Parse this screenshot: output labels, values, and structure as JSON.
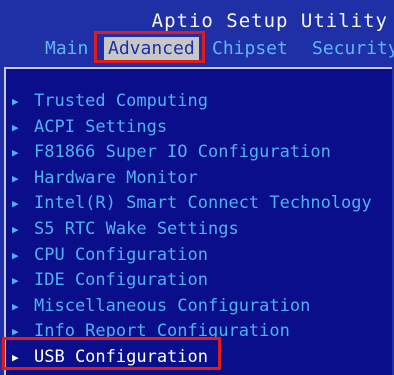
{
  "header": {
    "title": "Aptio Setup Utility",
    "tabs": [
      {
        "label": "Main"
      },
      {
        "label": "Advanced"
      },
      {
        "label": "Chipset"
      },
      {
        "label": "Security"
      }
    ],
    "active_tab": "Advanced"
  },
  "menu": {
    "items": [
      {
        "label": "Trusted Computing"
      },
      {
        "label": "ACPI Settings"
      },
      {
        "label": "F81866 Super IO Configuration"
      },
      {
        "label": "Hardware Monitor"
      },
      {
        "label": "Intel(R) Smart Connect Technology"
      },
      {
        "label": "S5 RTC Wake Settings"
      },
      {
        "label": "CPU Configuration"
      },
      {
        "label": "IDE Configuration"
      },
      {
        "label": "Miscellaneous Configuration"
      },
      {
        "label": "Info Report Configuration"
      },
      {
        "label": "USB Configuration"
      }
    ],
    "selected_item": "USB Configuration",
    "arrow_icon": "triangle-right-icon"
  },
  "colors": {
    "background": "#1f2fa6",
    "panel": "#0a0e8a",
    "text": "#4fb1f2",
    "title": "#f4f6ff",
    "active_tab_bg": "#c7c7c7",
    "highlight": "#e11a1a"
  }
}
